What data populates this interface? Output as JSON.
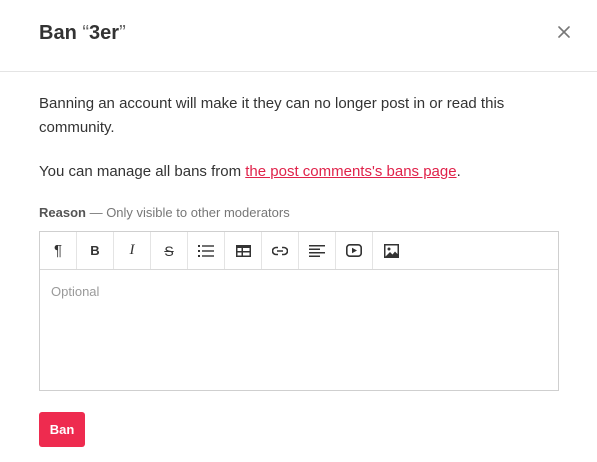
{
  "dialog": {
    "title_prefix": "Ban",
    "title_open_quote": "“",
    "title_name": "3er",
    "title_close_quote": "”",
    "close_icon": "close-icon"
  },
  "content": {
    "description": "Banning an account will make it they can no longer post in or read this community.",
    "manage_prefix": "You can manage all bans from ",
    "manage_link": "the post comments's bans page",
    "manage_suffix": "."
  },
  "reason": {
    "label": "Reason",
    "hint": " — Only visible to other moderators",
    "placeholder": "Optional"
  },
  "toolbar": {
    "paragraph": "¶",
    "bold": "B",
    "italic": "I",
    "strike": "S",
    "icons": [
      "paragraph-icon",
      "bold-icon",
      "italic-icon",
      "strikethrough-icon",
      "bullet-list-icon",
      "table-icon",
      "link-icon",
      "align-icon",
      "video-icon",
      "image-icon"
    ]
  },
  "actions": {
    "ban_label": "Ban"
  },
  "colors": {
    "accent": "#ee2b4f",
    "link": "#e0224a"
  }
}
